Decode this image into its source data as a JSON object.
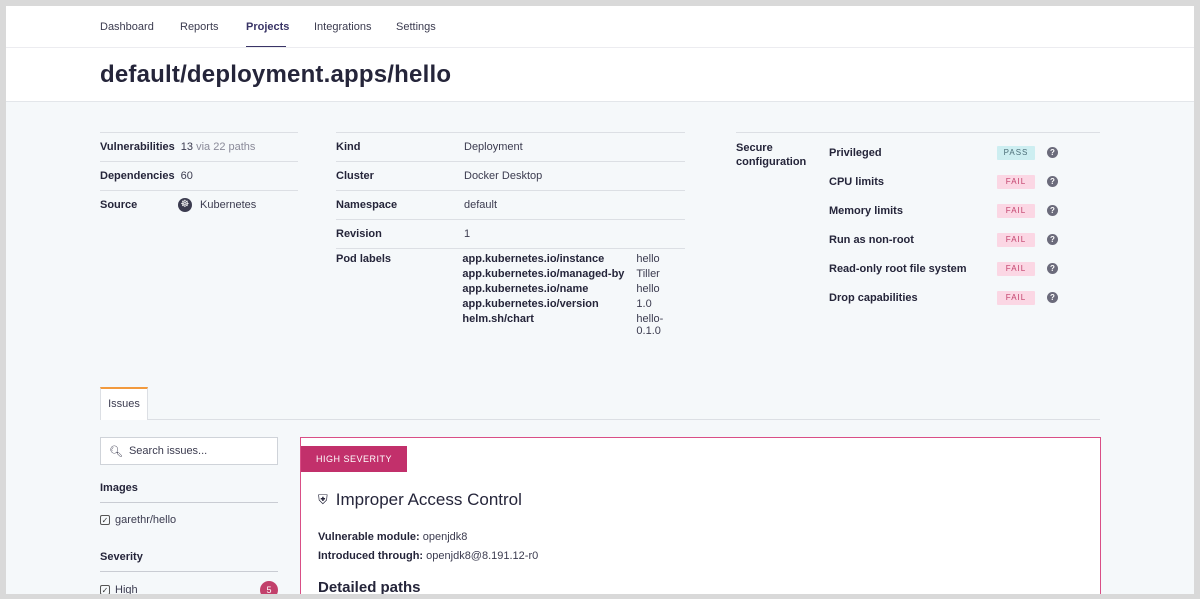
{
  "nav": {
    "items": [
      {
        "label": "Dashboard"
      },
      {
        "label": "Reports"
      },
      {
        "label": "Projects"
      },
      {
        "label": "Integrations"
      },
      {
        "label": "Settings"
      }
    ],
    "active": "Projects"
  },
  "page": {
    "title": "default/deployment.apps/hello"
  },
  "summary": {
    "vulnerabilities_label": "Vulnerabilities",
    "vulnerabilities_count": "13",
    "vulnerabilities_paths": "via 22 paths",
    "dependencies_label": "Dependencies",
    "dependencies_count": "60",
    "source_label": "Source",
    "source_value": "Kubernetes",
    "source_icon": "kubernetes-icon"
  },
  "details": {
    "kind_label": "Kind",
    "kind_value": "Deployment",
    "cluster_label": "Cluster",
    "cluster_value": "Docker Desktop",
    "namespace_label": "Namespace",
    "namespace_value": "default",
    "revision_label": "Revision",
    "revision_value": "1",
    "pod_labels_label": "Pod labels",
    "pod_labels": [
      {
        "key": "app.kubernetes.io/instance",
        "value": "hello"
      },
      {
        "key": "app.kubernetes.io/managed-by",
        "value": "Tiller"
      },
      {
        "key": "app.kubernetes.io/name",
        "value": "hello"
      },
      {
        "key": "app.kubernetes.io/version",
        "value": "1.0"
      },
      {
        "key": "helm.sh/chart",
        "value": "hello-0.1.0"
      }
    ]
  },
  "secure_config": {
    "label": "Secure configuration",
    "checks": [
      {
        "name": "Privileged",
        "status": "PASS"
      },
      {
        "name": "CPU limits",
        "status": "FAIL"
      },
      {
        "name": "Memory limits",
        "status": "FAIL"
      },
      {
        "name": "Run as non-root",
        "status": "FAIL"
      },
      {
        "name": "Read-only root file system",
        "status": "FAIL"
      },
      {
        "name": "Drop capabilities",
        "status": "FAIL"
      }
    ],
    "help_glyph": "?"
  },
  "tabs": {
    "issues_label": "Issues"
  },
  "sidebar": {
    "search_placeholder": "Search issues...",
    "images_heading": "Images",
    "images": [
      {
        "label": "garethr/hello",
        "checked": true
      }
    ],
    "severity_heading": "Severity",
    "severity": [
      {
        "label": "High",
        "checked": true,
        "count": "5"
      }
    ]
  },
  "issue": {
    "severity_badge": "HIGH SEVERITY",
    "title": "Improper Access Control",
    "vulnerable_module_label": "Vulnerable module:",
    "vulnerable_module_value": "openjdk8",
    "introduced_through_label": "Introduced through:",
    "introduced_through_value": "openjdk8@8.191.12-r0",
    "detailed_paths_heading": "Detailed paths"
  },
  "colors": {
    "accent": "#393466",
    "tab_accent": "#f29a3d",
    "high_severity": "#c2306b",
    "pass_bg": "#cdeef1",
    "fail_bg": "#fbd7e4"
  }
}
